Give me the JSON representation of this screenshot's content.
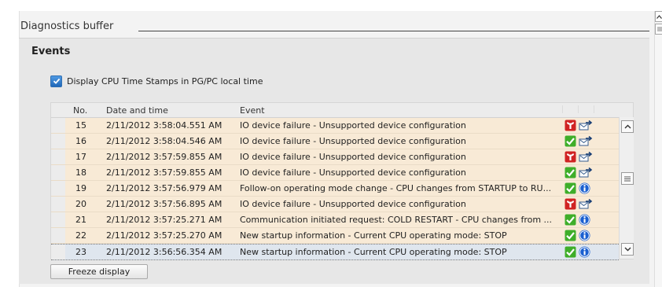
{
  "panel": {
    "title": "Diagnostics buffer"
  },
  "events_section": {
    "title": "Events",
    "timestamp_checkbox": {
      "label": "Display CPU Time Stamps in PG/PC local time",
      "checked": true
    },
    "columns": {
      "no": "No.",
      "datetime": "Date and time",
      "event": "Event"
    },
    "rows": [
      {
        "no": "15",
        "datetime": "2/11/2012 3:58:04.551 AM",
        "event": "IO device failure - Unsupported device configuration",
        "status_icon": "error-wrench-icon",
        "type_icon": "outgoing-event-icon"
      },
      {
        "no": "16",
        "datetime": "2/11/2012 3:58:04.546 AM",
        "event": "IO device failure - Unsupported device configuration",
        "status_icon": "ok-check-icon",
        "type_icon": "outgoing-event-icon"
      },
      {
        "no": "17",
        "datetime": "2/11/2012 3:57:59.855 AM",
        "event": "IO device failure - Unsupported device configuration",
        "status_icon": "error-wrench-icon",
        "type_icon": "outgoing-event-icon"
      },
      {
        "no": "18",
        "datetime": "2/11/2012 3:57:59.855 AM",
        "event": "IO device failure - Unsupported device configuration",
        "status_icon": "ok-check-icon",
        "type_icon": "outgoing-event-icon"
      },
      {
        "no": "19",
        "datetime": "2/11/2012 3:57:56.979 AM",
        "event": "Follow-on operating mode change  - CPU changes from STARTUP to RU...",
        "status_icon": "ok-check-icon",
        "type_icon": "info-icon"
      },
      {
        "no": "20",
        "datetime": "2/11/2012 3:57:56.895 AM",
        "event": "IO device failure - Unsupported device configuration",
        "status_icon": "error-wrench-icon",
        "type_icon": "outgoing-event-icon"
      },
      {
        "no": "21",
        "datetime": "2/11/2012 3:57:25.271 AM",
        "event": "Communication initiated request: COLD RESTART - CPU changes from ...",
        "status_icon": "ok-check-icon",
        "type_icon": "info-icon"
      },
      {
        "no": "22",
        "datetime": "2/11/2012 3:57:25.270 AM",
        "event": "New startup information  - Current CPU operating mode: STOP",
        "status_icon": "ok-check-icon",
        "type_icon": "info-icon"
      },
      {
        "no": "23",
        "datetime": "2/11/2012 3:56:56.354 AM",
        "event": "New startup information  - Current CPU operating mode: STOP",
        "status_icon": "ok-check-icon",
        "type_icon": "info-icon",
        "selected": true
      }
    ]
  },
  "buttons": {
    "freeze": "Freeze display"
  },
  "colors": {
    "row_background": "#f8ead6",
    "selected_row_background": "#dfe6ee",
    "ok_green": "#3fae2a",
    "error_red": "#d02323",
    "info_blue": "#1a5fd0"
  }
}
